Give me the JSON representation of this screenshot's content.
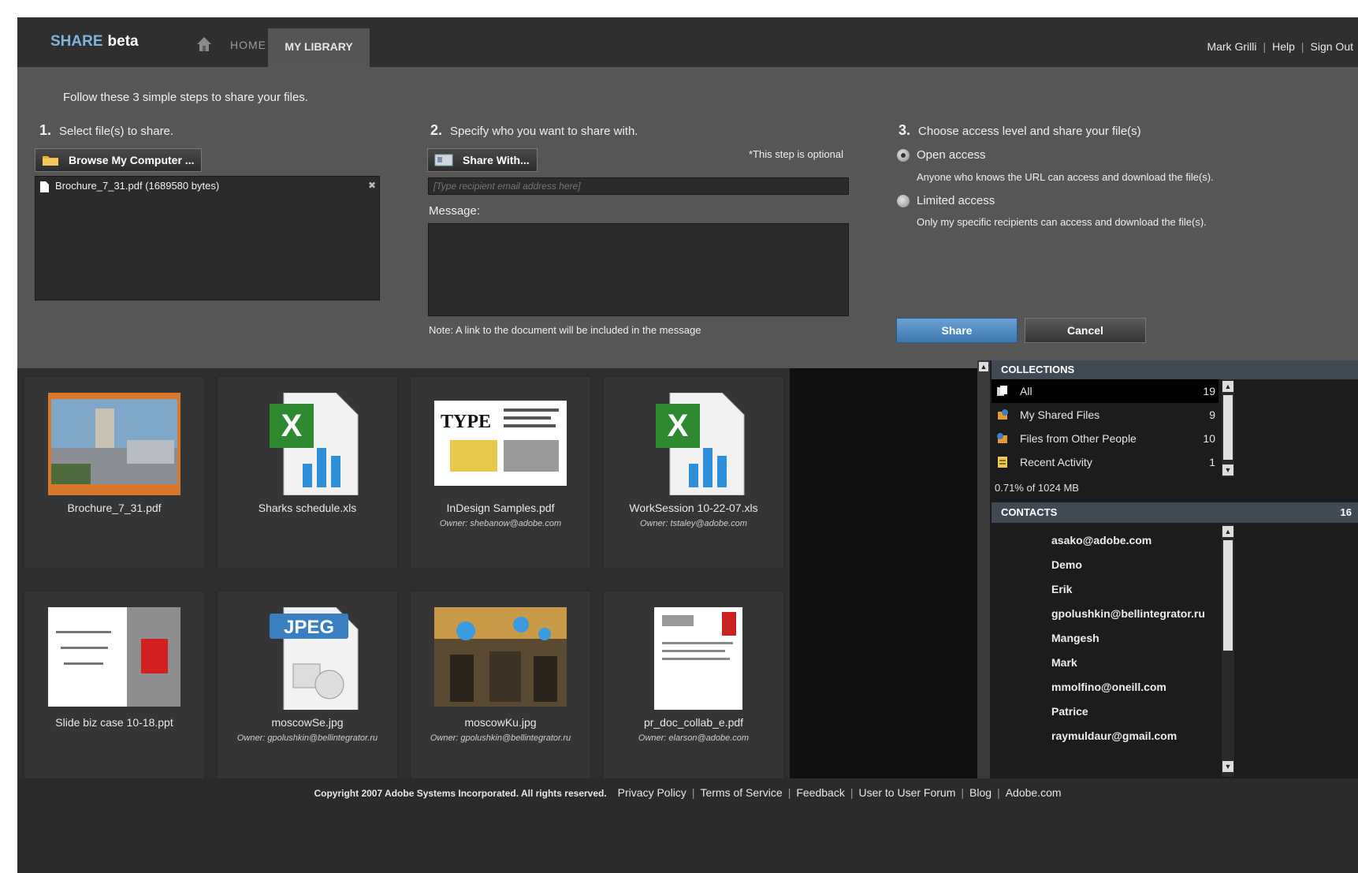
{
  "brand": {
    "name": "SHARE",
    "badge": "beta"
  },
  "nav": {
    "home_label": "HOME",
    "library_label": "MY LIBRARY"
  },
  "user": {
    "name": "Mark Grilli",
    "help": "Help",
    "signout": "Sign Out"
  },
  "share": {
    "intro": "Follow these 3 simple steps to share your files.",
    "step1": {
      "num": "1.",
      "title": "Select file(s) to share.",
      "browse_label": "Browse My Computer ...",
      "file": "Brochure_7_31.pdf (1689580 bytes)"
    },
    "step2": {
      "num": "2.",
      "title": "Specify who you want to share with.",
      "share_with_label": "Share With...",
      "optional_note": "*This step is optional",
      "recipient_placeholder": "[Type recipient email address here]",
      "message_label": "Message:",
      "note": "Note: A link to the document will be included in the message"
    },
    "step3": {
      "num": "3.",
      "title": "Choose access level and share your file(s)",
      "open_label": "Open access",
      "open_desc": "Anyone who knows the URL can access and download the file(s).",
      "limited_label": "Limited access",
      "limited_desc": "Only my specific recipients can access and download the file(s).",
      "share_label": "Share",
      "cancel_label": "Cancel"
    }
  },
  "files": [
    {
      "name": "Brochure_7_31.pdf",
      "owner": ""
    },
    {
      "name": "Sharks schedule.xls",
      "owner": ""
    },
    {
      "name": "InDesign Samples.pdf",
      "owner": "Owner: shebanow@adobe.com"
    },
    {
      "name": "WorkSession 10-22-07.xls",
      "owner": "Owner: tstaley@adobe.com"
    },
    {
      "name": "Slide biz case 10-18.ppt",
      "owner": ""
    },
    {
      "name": "moscowSe.jpg",
      "owner": "Owner: gpolushkin@bellintegrator.ru"
    },
    {
      "name": "moscowKu.jpg",
      "owner": "Owner: gpolushkin@bellintegrator.ru"
    },
    {
      "name": "pr_doc_collab_e.pdf",
      "owner": "Owner: elarson@adobe.com"
    }
  ],
  "thumb_text": {
    "type_word": "TYPE",
    "jpeg_word": "JPEG"
  },
  "collections": {
    "title": "COLLECTIONS",
    "items": [
      {
        "label": "All",
        "count": "19"
      },
      {
        "label": "My Shared Files",
        "count": "9"
      },
      {
        "label": "Files from Other People",
        "count": "10"
      },
      {
        "label": "Recent Activity",
        "count": "1"
      }
    ],
    "storage": "0.71% of 1024 MB"
  },
  "contacts": {
    "title": "CONTACTS",
    "count": "16",
    "items": [
      "asako@adobe.com",
      "Demo",
      "Erik",
      "gpolushkin@bellintegrator.ru",
      "Mangesh",
      "Mark",
      "mmolfino@oneill.com",
      "Patrice",
      "raymuldaur@gmail.com"
    ]
  },
  "footer": {
    "copyright": "Copyright 2007 Adobe Systems Incorporated. All rights reserved.",
    "links": [
      "Privacy Policy",
      "Terms of Service",
      "Feedback",
      "User to User Forum",
      "Blog",
      "Adobe.com"
    ]
  },
  "colors": {
    "accent": "#4a86c0",
    "panel": "#565656",
    "header": "#2f2f2f"
  }
}
